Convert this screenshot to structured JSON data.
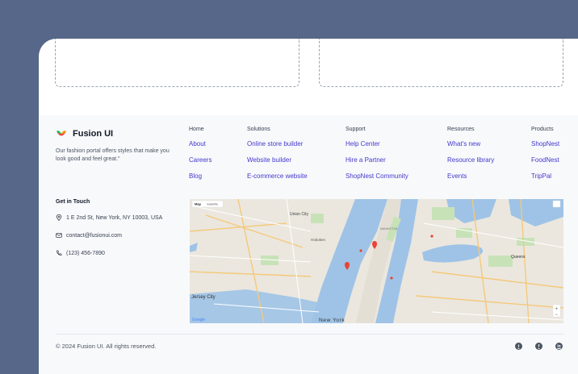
{
  "brand": {
    "name": "Fusion UI",
    "tagline": "Our fashion portal offers styles that make you look good and feel great.\""
  },
  "columns": [
    {
      "title": "Home",
      "links": [
        "About",
        "Careers",
        "Blog"
      ]
    },
    {
      "title": "Solutions",
      "links": [
        "Online store builder",
        "Website builder",
        "E-commerce website"
      ]
    },
    {
      "title": "Support",
      "links": [
        "Help Center",
        "Hire a Partner",
        "ShopNest Community"
      ]
    },
    {
      "title": "Resources",
      "links": [
        "What's new",
        "Resource library",
        "Events"
      ]
    },
    {
      "title": "Products",
      "links": [
        "ShopNest",
        "FoodNest",
        "TripPal"
      ]
    }
  ],
  "contact": {
    "title": "Get in Touch",
    "address": "1 E 2nd St, New York, NY 10003, USA",
    "email": "contact@fusionui.com",
    "phone": "(123) 456-7890"
  },
  "map": {
    "tab_map": "Map",
    "tab_satellite": "Satellite",
    "labels": {
      "union_city": "Union City",
      "new_york": "New York",
      "jersey_city": "Jersey City",
      "hoboken": "Hoboken",
      "queens": "Queens",
      "google": "Google",
      "manhattan": "MANHATTAN"
    },
    "zoom_in": "+",
    "zoom_out": "−"
  },
  "footer": {
    "copyright": "© 2024 Fusion UI. All rights reserved."
  },
  "socials": [
    "twitter-icon",
    "facebook-icon",
    "linkedin-icon"
  ],
  "colors": {
    "background": "#576789",
    "link": "#4338ca",
    "footer_bg": "#f8f9fb",
    "water": "#9fc3e7",
    "marker": "#ea4335"
  }
}
